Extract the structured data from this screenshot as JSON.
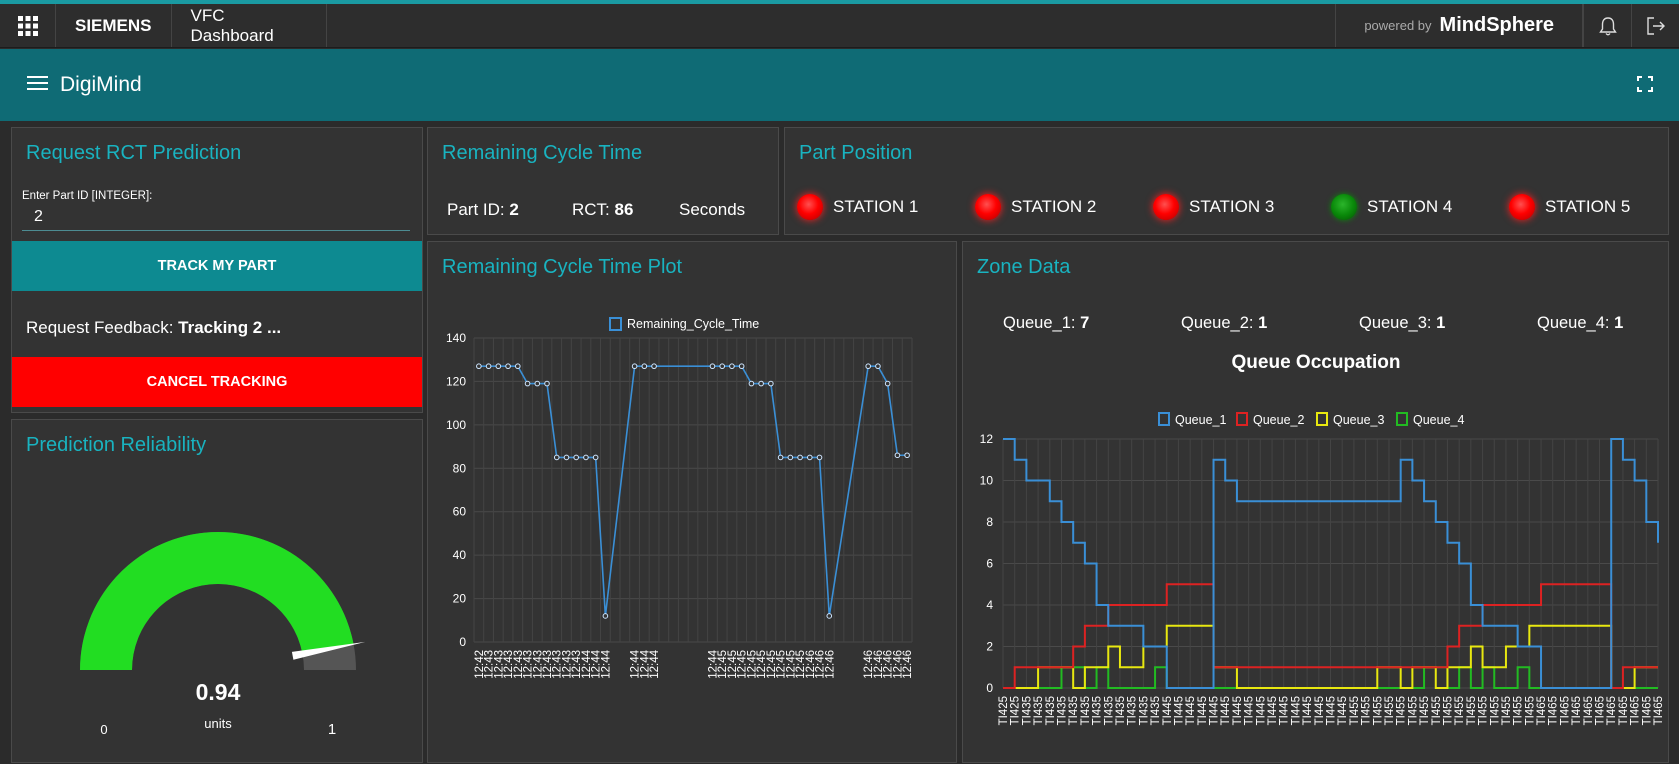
{
  "topbar": {
    "brand": "SIEMENS",
    "app_name": "VFC Dashboard",
    "powered_by": "powered by",
    "platform": "MindSphere"
  },
  "header": {
    "title": "DigiMind"
  },
  "request_panel": {
    "title": "Request RCT Prediction",
    "field_label": "Enter Part ID [INTEGER]:",
    "field_value": "2",
    "track_button": "TRACK MY PART",
    "feedback_label": "Request Feedback:",
    "feedback_value": "Tracking 2 ...",
    "cancel_button": "CANCEL TRACKING",
    "colors": {
      "track": "#0d8a91",
      "cancel": "#ff0000"
    }
  },
  "reliability_panel": {
    "title": "Prediction Reliability",
    "value": "0.94",
    "value_fraction": 0.94,
    "units": "units",
    "min": "0",
    "max": "1",
    "gauge_color": "#22dd22"
  },
  "rct_panel": {
    "title": "Remaining Cycle Time",
    "part_label": "Part ID:",
    "part_value": "2",
    "rct_label": "RCT:",
    "rct_value": "86",
    "unit": "Seconds"
  },
  "position_panel": {
    "title": "Part Position",
    "stations": [
      {
        "label": "STATION 1",
        "status": "red"
      },
      {
        "label": "STATION 2",
        "status": "red"
      },
      {
        "label": "STATION 3",
        "status": "red"
      },
      {
        "label": "STATION 4",
        "status": "green"
      },
      {
        "label": "STATION 5",
        "status": "red"
      }
    ]
  },
  "plot_panel": {
    "title": "Remaining Cycle Time Plot"
  },
  "zone_panel": {
    "title": "Zone Data",
    "queues": [
      {
        "label": "Queue_1:",
        "value": "7"
      },
      {
        "label": "Queue_2:",
        "value": "1"
      },
      {
        "label": "Queue_3:",
        "value": "1"
      },
      {
        "label": "Queue_4:",
        "value": "1"
      }
    ]
  },
  "chart_data": [
    {
      "type": "line",
      "title": "",
      "series": [
        {
          "name": "Remaining_Cycle_Time",
          "color": "#3a8fd6",
          "values": [
            127,
            127,
            127,
            127,
            127,
            119,
            119,
            119,
            85,
            85,
            85,
            85,
            85,
            12,
            127,
            127,
            127,
            127,
            127,
            127,
            127,
            119,
            119,
            119,
            85,
            85,
            85,
            85,
            85,
            12,
            127,
            127,
            119,
            86,
            86
          ]
        }
      ],
      "x": [
        "12:42",
        "12:43",
        "12:43",
        "12:43",
        "12:43",
        "12:43",
        "12:43",
        "12:43",
        "12:43",
        "12:43",
        "12:43",
        "12:44",
        "12:44",
        "12:44",
        "12:44",
        "12:44",
        "12:44",
        "12:44",
        "12:45",
        "12:45",
        "12:45",
        "12:45",
        "12:45",
        "12:45",
        "12:45",
        "12:45",
        "12:45",
        "12:46",
        "12:46",
        "12:46",
        "12:46",
        "12:46",
        "12:46",
        "12:46",
        "12:46"
      ],
      "point_index": [
        0,
        1,
        2,
        3,
        4,
        5,
        6,
        7,
        8,
        9,
        10,
        11,
        12,
        13,
        16,
        17,
        18,
        24,
        25,
        26,
        27,
        28,
        29,
        30,
        31,
        32,
        33,
        34,
        35,
        36,
        40,
        41,
        42,
        43,
        44
      ],
      "ylim": [
        0,
        140
      ],
      "yticks": [
        0,
        20,
        40,
        60,
        80,
        100,
        120,
        140
      ],
      "legend": "top-center",
      "grid": true
    },
    {
      "type": "line",
      "title": "Queue Occupation",
      "series": [
        {
          "name": "Queue_1",
          "color": "#3a8fd6",
          "values": [
            12,
            11,
            10,
            10,
            9,
            8,
            7,
            6,
            4,
            3,
            3,
            3,
            2,
            2,
            0,
            0,
            0,
            0,
            11,
            10,
            9,
            9,
            9,
            9,
            9,
            9,
            9,
            9,
            9,
            9,
            9,
            9,
            9,
            9,
            11,
            10,
            9,
            8,
            7,
            6,
            4,
            3,
            3,
            3,
            2,
            2,
            0,
            0,
            0,
            0,
            0,
            0,
            12,
            11,
            10,
            8,
            7
          ]
        },
        {
          "name": "Queue_2",
          "color": "#dd2222",
          "values": [
            0,
            1,
            1,
            1,
            1,
            1,
            2,
            3,
            3,
            4,
            4,
            4,
            4,
            4,
            5,
            5,
            5,
            5,
            1,
            1,
            1,
            1,
            1,
            1,
            1,
            1,
            1,
            1,
            1,
            1,
            1,
            1,
            1,
            1,
            1,
            1,
            1,
            1,
            2,
            3,
            3,
            4,
            4,
            4,
            4,
            4,
            5,
            5,
            5,
            5,
            5,
            5,
            0,
            1,
            1,
            1,
            1
          ]
        },
        {
          "name": "Queue_3",
          "color": "#e8e810",
          "values": [
            0,
            0,
            0,
            1,
            1,
            1,
            0,
            1,
            1,
            2,
            1,
            1,
            2,
            2,
            3,
            3,
            3,
            3,
            1,
            1,
            0,
            0,
            0,
            0,
            0,
            0,
            0,
            0,
            0,
            0,
            0,
            0,
            1,
            1,
            0,
            1,
            1,
            0,
            1,
            1,
            2,
            1,
            1,
            2,
            2,
            3,
            3,
            3,
            3,
            3,
            3,
            3,
            0,
            0,
            1,
            1,
            1
          ]
        },
        {
          "name": "Queue_4",
          "color": "#22bb22",
          "values": [
            0,
            0,
            0,
            0,
            0,
            1,
            1,
            0,
            1,
            0,
            0,
            0,
            0,
            1,
            0,
            0,
            0,
            0,
            0,
            0,
            0,
            0,
            0,
            0,
            0,
            0,
            0,
            0,
            0,
            0,
            0,
            0,
            0,
            0,
            0,
            0,
            1,
            1,
            0,
            1,
            0,
            1,
            0,
            0,
            1,
            0,
            0,
            0,
            0,
            0,
            0,
            0,
            0,
            0,
            0,
            0,
            0
          ]
        }
      ],
      "x_labels": [
        "TI425",
        "TI425",
        "TI435",
        "TI435",
        "TI435",
        "TI435",
        "TI435",
        "TI435",
        "TI435",
        "TI435",
        "TI435",
        "TI435",
        "TI435",
        "TI435",
        "TI445",
        "TI445",
        "TI445",
        "TI445",
        "TI445",
        "TI445",
        "TI445",
        "TI445",
        "TI445",
        "TI445",
        "TI445",
        "TI445",
        "TI445",
        "TI445",
        "TI445",
        "TI445",
        "TI455",
        "TI455",
        "TI455",
        "TI455",
        "TI455",
        "TI455",
        "TI455",
        "TI455",
        "TI455",
        "TI455",
        "TI455",
        "TI455",
        "TI455",
        "TI455",
        "TI455",
        "TI455",
        "TI465",
        "TI465",
        "TI465",
        "TI465",
        "TI465",
        "TI465",
        "TI465",
        "TI465",
        "TI465",
        "TI465",
        "TI465"
      ],
      "ylim": [
        0,
        12
      ],
      "yticks": [
        0,
        2,
        4,
        6,
        8,
        10,
        12
      ],
      "legend": "top-center",
      "grid": true,
      "step": true
    }
  ]
}
